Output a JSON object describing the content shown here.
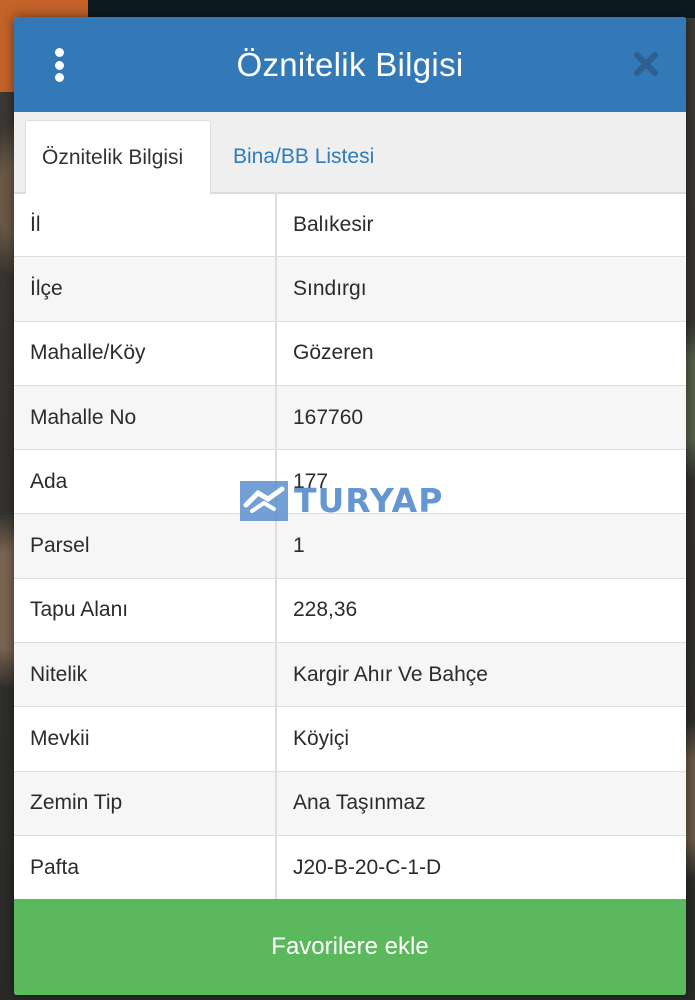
{
  "header": {
    "title": "Öznitelik Bilgisi",
    "menu_icon": "vertical-dots-icon",
    "close_icon": "close-icon",
    "color": "#3479b7"
  },
  "tabs": [
    {
      "label": "Öznitelik Bilgisi",
      "active": true
    },
    {
      "label": "Bina/BB Listesi",
      "active": false
    }
  ],
  "attributes": [
    {
      "key": "İl",
      "value": "Balıkesir"
    },
    {
      "key": "İlçe",
      "value": "Sındırgı"
    },
    {
      "key": "Mahalle/Köy",
      "value": "Gözeren"
    },
    {
      "key": "Mahalle No",
      "value": "167760"
    },
    {
      "key": "Ada",
      "value": "177"
    },
    {
      "key": "Parsel",
      "value": "1"
    },
    {
      "key": "Tapu Alanı",
      "value": "228,36"
    },
    {
      "key": "Nitelik",
      "value": "Kargir Ahır Ve Bahçe"
    },
    {
      "key": "Mevkii",
      "value": "Köyiçi"
    },
    {
      "key": "Zemin Tip",
      "value": "Ana Taşınmaz"
    },
    {
      "key": "Pafta",
      "value": "J20-B-20-C-1-D"
    }
  ],
  "watermark": {
    "text": "TURYAP",
    "color": "#4a84c9"
  },
  "favorite_button": {
    "label": "Favorilere ekle",
    "color": "#5cb85c"
  }
}
